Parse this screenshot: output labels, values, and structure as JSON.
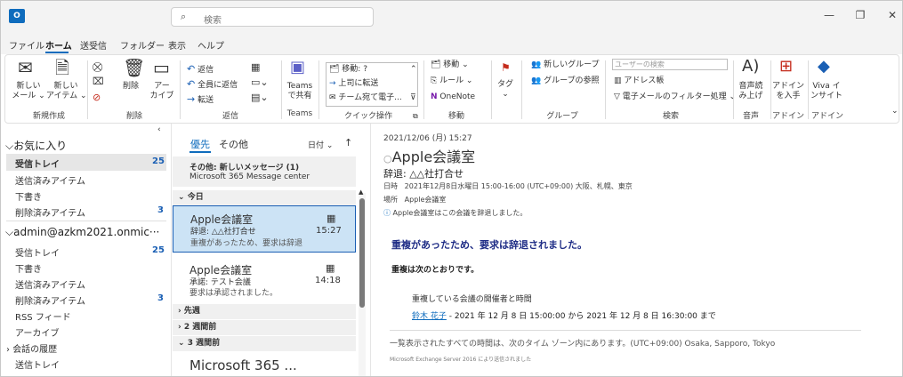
{
  "titlebar": {
    "app_icon": "outlook-icon",
    "search_placeholder": "検索",
    "controls": [
      "minimize-icon",
      "restore-icon",
      "close-icon"
    ]
  },
  "menu": [
    "ファイル",
    "ホーム",
    "送受信",
    "フォルダー",
    "表示",
    "ヘルプ"
  ],
  "ribbon": {
    "new_mail": [
      "新しい",
      "メール ⌄"
    ],
    "new_item": [
      "新しい",
      "アイテム ⌄"
    ],
    "delete_label": "削除",
    "archive": [
      "アー",
      "カイブ"
    ],
    "reply": "返信",
    "reply_all": "全員に返信",
    "forward": "転送",
    "teams": [
      "Teams",
      "で共有"
    ],
    "quick_steps": [
      "移動: ?",
      "上司に転送",
      "チーム宛て電子..."
    ],
    "move": "移動 ⌄",
    "rules": "ルール ⌄",
    "onenote": "OneNote",
    "tags": "タグ",
    "new_group": "新しいグループ",
    "browse_groups": "グループの参照",
    "search_people_placeholder": "ユーザーの検索",
    "address_book": "アドレス帳",
    "filter_email": "電子メールのフィルター処理 ⌄",
    "read_aloud": [
      "音声読",
      "み上げ"
    ],
    "get_addins": [
      "アドイン",
      "を入手"
    ],
    "viva": [
      "Viva イ",
      "ンサイト"
    ],
    "groups": [
      "新規作成",
      "削除",
      "返信",
      "Teams",
      "クイック操作",
      "移動",
      "グループ",
      "検索",
      "音声",
      "アドイン",
      "アドイン"
    ]
  },
  "folders": {
    "favorites_header": "お気に入り",
    "favorites": [
      {
        "label": "受信トレイ",
        "count": "25"
      },
      {
        "label": "送信済みアイテム",
        "count": ""
      },
      {
        "label": "下書き",
        "count": ""
      },
      {
        "label": "削除済みアイテム",
        "count": "3"
      }
    ],
    "account_header": "admin@azkm2021.onmic···",
    "account": [
      {
        "label": "受信トレイ",
        "count": "25"
      },
      {
        "label": "下書き",
        "count": ""
      },
      {
        "label": "送信済みアイテム",
        "count": ""
      },
      {
        "label": "削除済みアイテム",
        "count": "3"
      },
      {
        "label": "RSS フィード",
        "count": ""
      },
      {
        "label": "アーカイブ",
        "count": ""
      },
      {
        "label": "会話の履歴",
        "count": ""
      },
      {
        "label": "送信トレイ",
        "count": ""
      }
    ]
  },
  "list": {
    "tab_focused": "優先",
    "tab_other": "その他",
    "sort": "日付 ⌄",
    "sort_arrow": "↑",
    "other_notice_title": "その他: 新しいメッセージ (1)",
    "other_notice_sender": "Microsoft 365 Message center",
    "group_today": "今日",
    "messages": [
      {
        "sender": "Apple会議室",
        "subject": "辞退: △△社打合せ",
        "preview": "重複があったため、要求は辞退",
        "time": "15:27"
      },
      {
        "sender": "Apple会議室",
        "subject": "承諾: テスト会議",
        "preview": "要求は承認されました。",
        "time": "14:18"
      }
    ],
    "group_last_week": "先週",
    "group_2weeks": "2 週間前",
    "group_3weeks": "3 週間前",
    "next_sender": "Microsoft 365 ..."
  },
  "reading": {
    "date": "2021/12/06 (月) 15:27",
    "sender": "Apple会議室",
    "subject": "辞退: △△社打合せ",
    "when_label": "日時",
    "when_value": "2021年12月8日水曜日 15:00-16:00 (UTC+09:00) 大阪、札幌、東京",
    "where_label": "場所",
    "where_value": "Apple会議室",
    "info": "Apple会議室はこの会議を辞退しました。",
    "body_heading": "重複があったため、要求は辞退されました。",
    "body_intro": "重複は次のとおりです。",
    "conflict_title": "重複している会議の開催者と時間",
    "organizer": "鈴木 花子",
    "conflict_time": " - 2021 年 12 月 8 日 15:00:00 から 2021 年 12 月 8 日 16:30:00 まで",
    "tz_note": "一覧表示されたすべての時間は、次のタイム ゾーン内にあります。(UTC+09:00) Osaka, Sapporo, Tokyo",
    "footer": "Microsoft Exchange Server 2016 により送信されました"
  },
  "colors": {
    "accent": "#0f6cbd",
    "selected": "#cce3f5",
    "heading": "#1f2d86"
  }
}
